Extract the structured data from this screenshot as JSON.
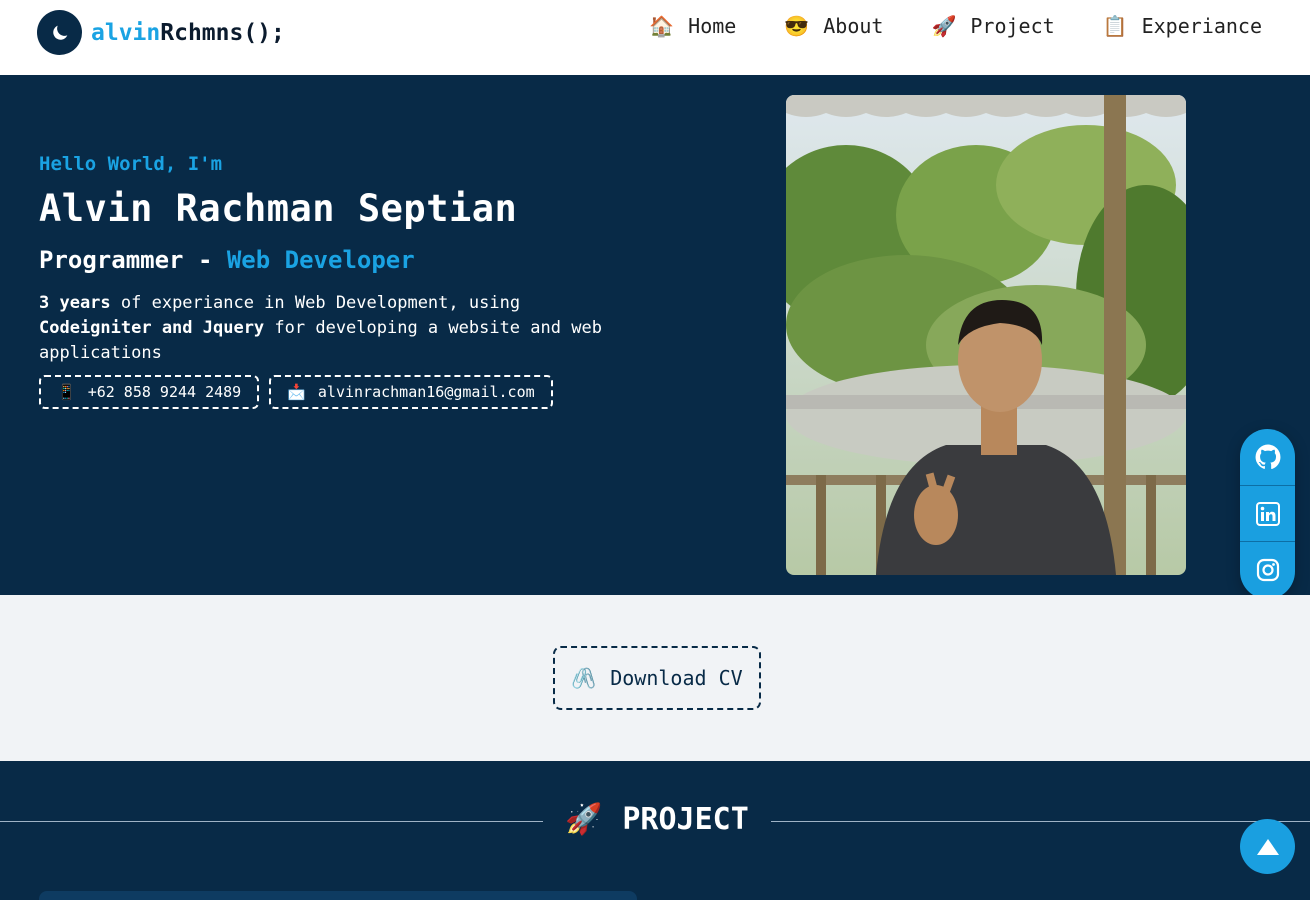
{
  "brand": {
    "accent": "alvin",
    "rest": "Rchmns();"
  },
  "nav": [
    {
      "emoji": "🏠",
      "label": "Home"
    },
    {
      "emoji": "😎",
      "label": "About"
    },
    {
      "emoji": "🚀",
      "label": "Project"
    },
    {
      "emoji": "📋",
      "label": "Experiance"
    }
  ],
  "hero": {
    "greeting": "Hello World, I'm",
    "name": "Alvin Rachman Septian",
    "role_prefix": "Programmer - ",
    "role_accent": "Web Developer",
    "desc_bold1": "3 years",
    "desc_text1": " of experiance in Web Development, using ",
    "desc_bold2": "Codeigniter and Jquery",
    "desc_text2": " for developing a website and web applications",
    "phone_icon": "📱",
    "phone": "+62 858 9244 2489",
    "email_icon": "📩",
    "email": "alvinrachman16@gmail.com"
  },
  "social": [
    "github-icon",
    "linkedin-icon",
    "instagram-icon"
  ],
  "download": {
    "icon": "🖇️",
    "label": "Download CV"
  },
  "project": {
    "emoji": "🚀",
    "title": "PROJECT"
  },
  "colors": {
    "navy": "#082a47",
    "accent": "#1aa3e3",
    "light": "#f1f3f6"
  }
}
